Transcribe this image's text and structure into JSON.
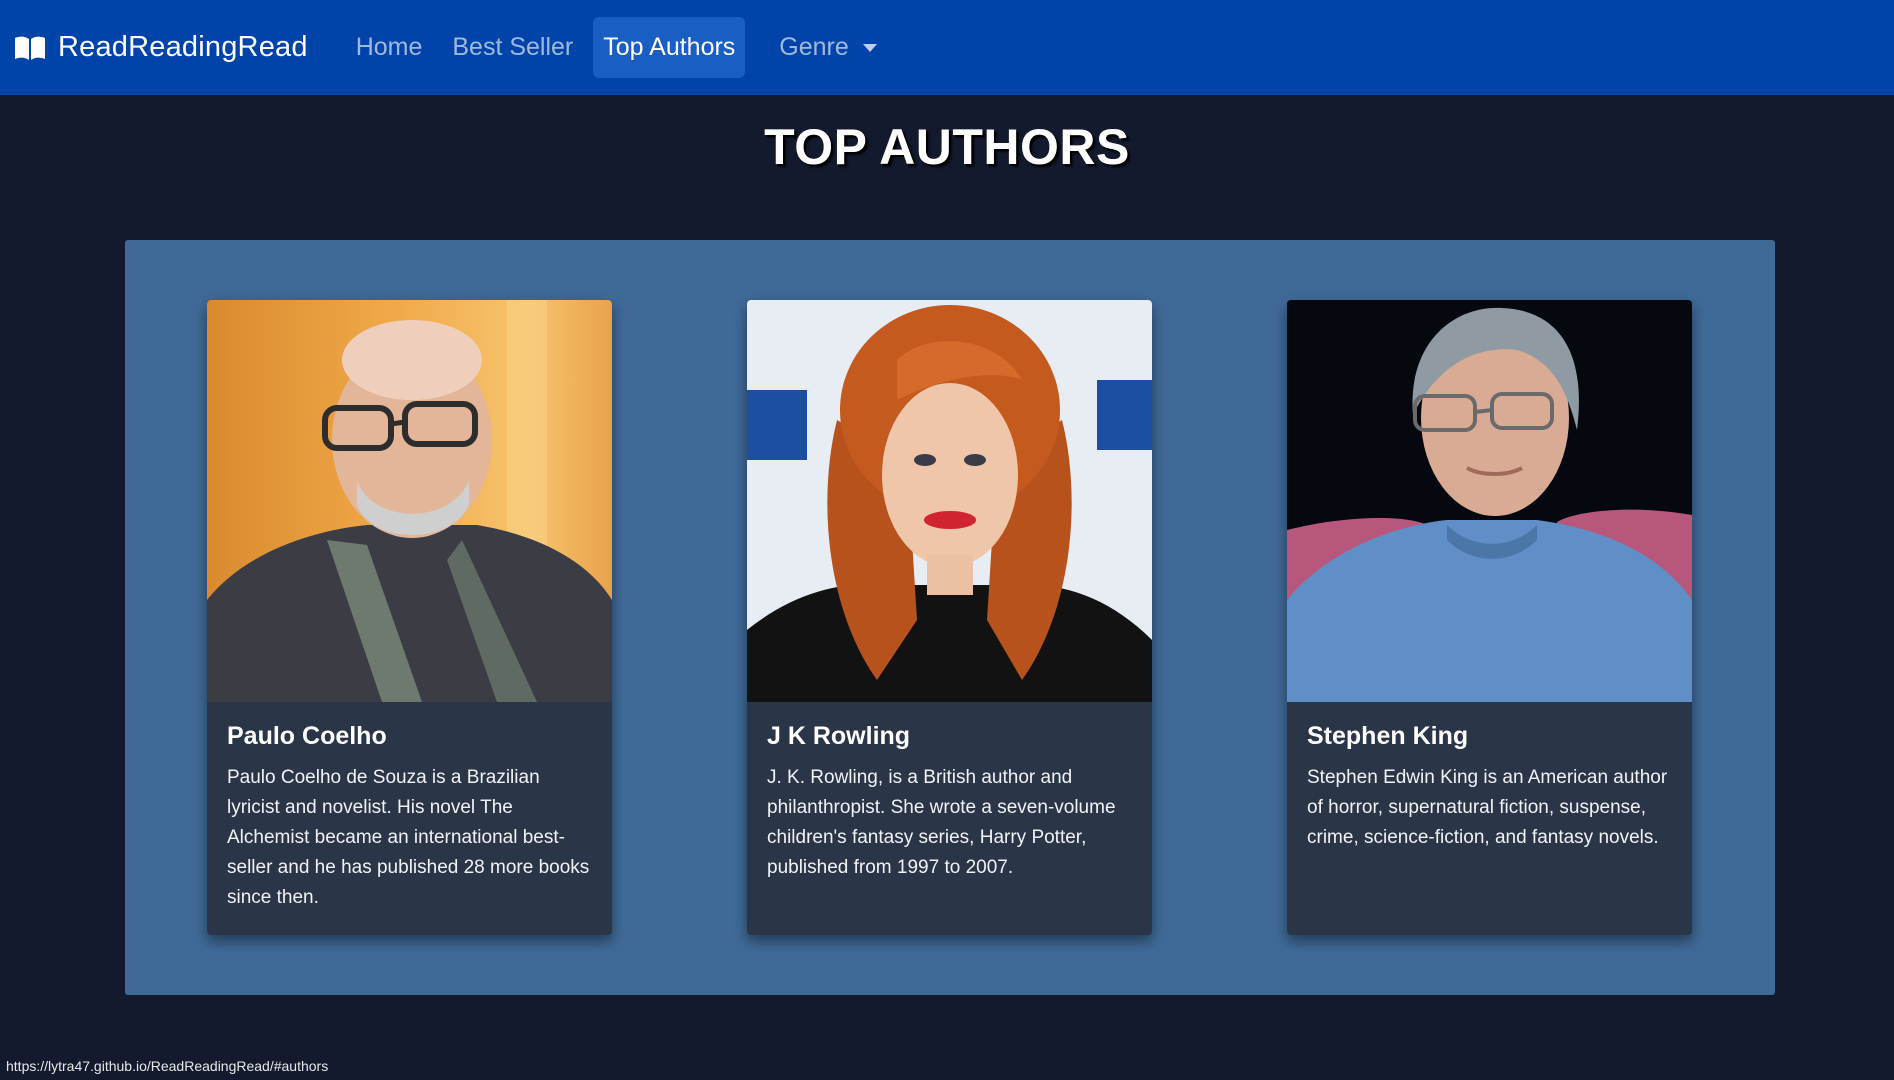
{
  "brand": {
    "name": "ReadReadingRead",
    "icon": "open-book-icon"
  },
  "nav": {
    "home": "Home",
    "best_seller": "Best Seller",
    "top_authors": "Top Authors",
    "genre": "Genre",
    "active": "top_authors"
  },
  "page": {
    "title": "TOP AUTHORS"
  },
  "authors": [
    {
      "name": "Paulo Coelho",
      "bio": "Paulo Coelho de Souza is a Brazilian lyricist and novelist. His novel The Alchemist became an international best-seller and he has published 28 more books since then."
    },
    {
      "name": "J K Rowling",
      "bio": "J. K. Rowling, is a British author and philanthropist. She wrote a seven-volume children's fantasy series, Harry Potter, published from 1997 to 2007."
    },
    {
      "name": "Stephen King",
      "bio": "Stephen Edwin King is an American author of horror, supernatural fiction, suspense, crime, science-fiction, and fantasy novels."
    }
  ],
  "status": {
    "url": "https://lytra47.github.io/ReadReadingRead/#authors"
  },
  "colors": {
    "navbar": "#0044aa",
    "background": "#131a2e",
    "panel": "#3f6a98",
    "card": "#2a3548"
  }
}
